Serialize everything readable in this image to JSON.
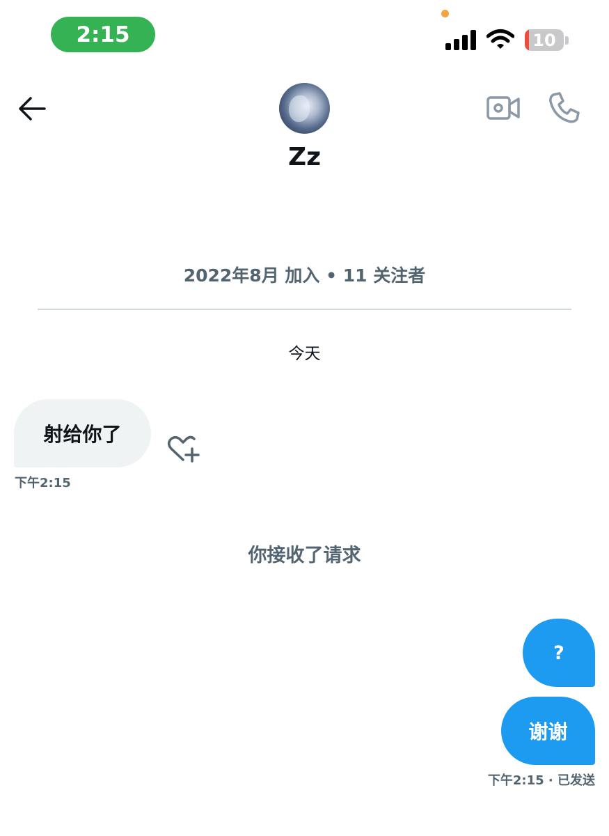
{
  "status_bar": {
    "time": "2:15",
    "battery_level": "10",
    "battery_fraction": 0.1,
    "colors": {
      "time_pill": "#34b254",
      "privacy_dot": "#f5a33c",
      "battery_low": "#eb4e3d"
    }
  },
  "header": {
    "contact_name": "Zz",
    "icons": [
      "back-arrow-icon",
      "video-call-icon",
      "phone-call-icon"
    ]
  },
  "profile": {
    "meta": "2022年8月 加入 • 11 关注者"
  },
  "conversation": {
    "date_label": "今天",
    "received": {
      "text": "射给你了",
      "time": "下午2:15"
    },
    "system_note": "你接收了请求",
    "sent": [
      {
        "text": "?"
      },
      {
        "text": "谢谢"
      }
    ],
    "sent_status": "下午2:15 · 已发送"
  },
  "colors": {
    "accent_blue": "#1d9bf0",
    "received_bubble": "#eff3f4",
    "secondary_text": "#536471"
  }
}
